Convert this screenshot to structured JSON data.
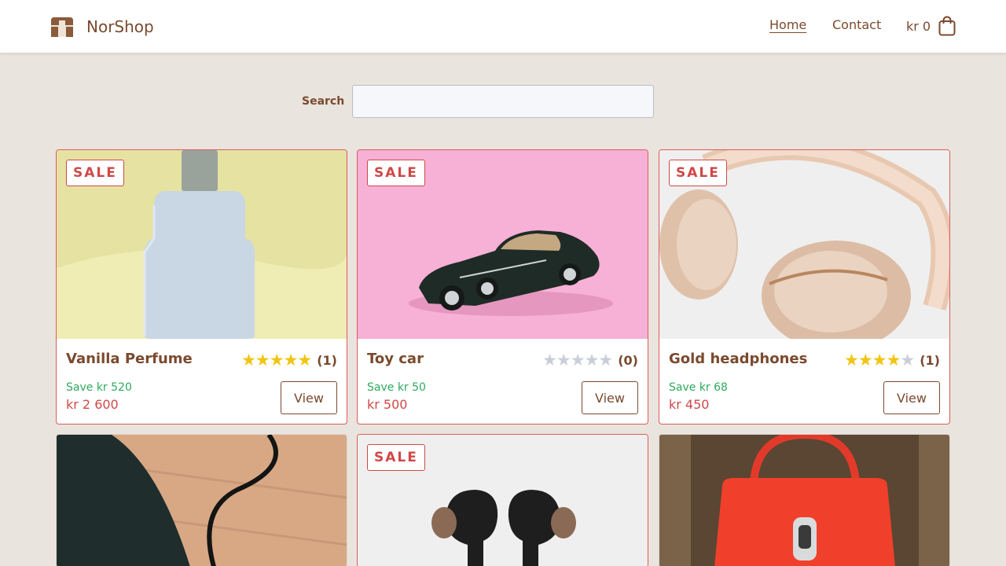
{
  "header": {
    "brand": "NorShop",
    "nav": {
      "home": "Home",
      "contact": "Contact"
    },
    "cart_total": "kr 0",
    "logo_icon": "shop-store-icon",
    "cart_icon": "shopping-bag-icon"
  },
  "search": {
    "label": "Search",
    "value": "",
    "placeholder": ""
  },
  "colors": {
    "accent": "#7a4a2e",
    "sale": "#d04848",
    "save": "#2eaa5c",
    "star": "#f2c40f",
    "background": "#e9e4de"
  },
  "products": [
    {
      "name": "Vanilla Perfume",
      "sale_label": "SALE",
      "rating": 5,
      "rating_count": "(1)",
      "save": "Save kr 520",
      "price": "kr 2 600",
      "view_label": "View",
      "image": "perfume bottle on yellow background"
    },
    {
      "name": "Toy car",
      "sale_label": "SALE",
      "rating": 0,
      "rating_count": "(0)",
      "save": "Save kr 50",
      "price": "kr 500",
      "view_label": "View",
      "image": "black toy car on pink background"
    },
    {
      "name": "Gold headphones",
      "sale_label": "SALE",
      "rating": 4,
      "rating_count": "(1)",
      "save": "Save kr 68",
      "price": "kr 450",
      "view_label": "View",
      "image": "gold headphones on white background"
    },
    {
      "image": "phone with cable on wooden table"
    },
    {
      "sale_label": "SALE",
      "image": "wireless earbuds on white background"
    },
    {
      "image": "red handbag"
    }
  ]
}
